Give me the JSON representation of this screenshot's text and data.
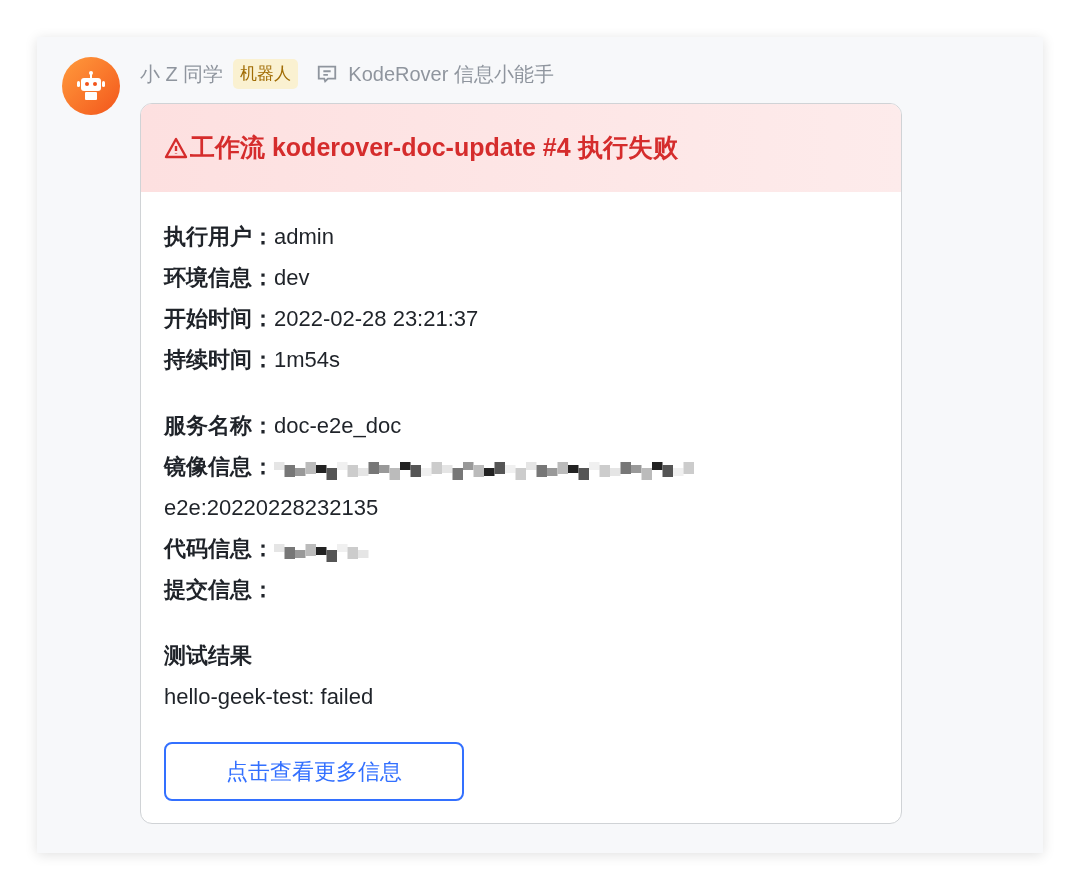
{
  "sender": {
    "name": "小 Z 同学",
    "badge": "机器人",
    "source": "KodeRover 信息小能手"
  },
  "card": {
    "title": "工作流 koderover-doc-update #4 执行失败",
    "sections": [
      {
        "rows": [
          {
            "kind": "plain",
            "label": "执行用户：",
            "value": "admin"
          },
          {
            "kind": "plain",
            "label": "环境信息：",
            "value": "dev"
          },
          {
            "kind": "plain",
            "label": "开始时间：",
            "value": "2022-02-28 23:21:37"
          },
          {
            "kind": "plain",
            "label": "持续时间：",
            "value": "1m54s"
          }
        ]
      },
      {
        "rows": [
          {
            "kind": "plain",
            "label": "服务名称：",
            "value": "doc-e2e_doc"
          },
          {
            "kind": "redacted-long",
            "label": "镜像信息：",
            "value": "e2e:20220228232135"
          },
          {
            "kind": "redacted-short",
            "label": "代码信息："
          },
          {
            "kind": "plain",
            "label": "提交信息："
          }
        ]
      },
      {
        "heading": "测试结果",
        "lines": [
          "hello-geek-test: failed"
        ]
      }
    ],
    "button": "点击查看更多信息"
  }
}
